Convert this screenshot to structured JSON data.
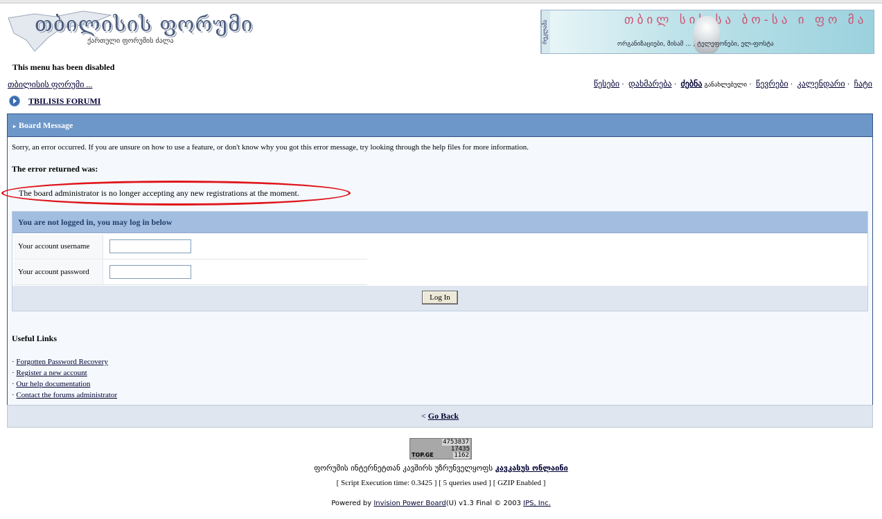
{
  "header": {
    "logo_title": "თბილისის ფორუმი",
    "logo_subtitle": "ქართული ფორუმის ძალა",
    "banner_tab": "რეკლამა",
    "banner_title": "თბილ სის სა ბო-სა ი ფო მა ო ს ცი ა",
    "banner_subtitle": "ორგანიზაციები, მისამ ... , ტელეფონები, ელ-ფოსტა"
  },
  "menu_disabled": "This menu has been disabled",
  "breadcrumb": "თბილისის ფორუმი ...",
  "nav": {
    "rules": "წესები",
    "help": "დახმარება",
    "search": "ძებნა",
    "search_note": "განახლებული",
    "members": "წევრები",
    "calendar": "კალენდარი",
    "chat": "ჩატი"
  },
  "forum_title": "TBILISIS FORUMI",
  "board": {
    "title": "Board Message",
    "message": "Sorry, an error occurred. If you are unsure on how to use a feature, or don't know why you got this error message, try looking through the help files for more information.",
    "error_label": "The error returned was:",
    "error_text": "The board administrator is no longer accepting any new registrations at the moment."
  },
  "login": {
    "title": "You are not logged in, you may log in below",
    "username_label": "Your account username",
    "username_value": "",
    "password_label": "Your account password",
    "password_value": "",
    "button": "Log In"
  },
  "useful": {
    "title": "Useful Links",
    "links": [
      "Forgotten Password Recovery",
      "Register a new account",
      "Our help documentation",
      "Contact the forums administrator"
    ]
  },
  "goback": {
    "prefix": "<",
    "label": "Go Back"
  },
  "counter": {
    "line1": "4753837",
    "line2": "17435",
    "line3": "1162",
    "brand": "TOP.GE"
  },
  "footer": {
    "isp_text": "ფორუმის ინტერნეტთან კავშირს უზრუნველყოფს",
    "isp_link": "კავკასუს ონლაინი",
    "stats": "[ Script Execution time: 0.3425 ]   [ 5 queries used ]   [ GZIP Enabled ]",
    "powered_prefix": "Powered by",
    "powered_link": "Invision Power Board",
    "powered_version": "(U) v1.3 Final © 2003",
    "ips_link": "IPS, Inc."
  },
  "colors": {
    "header_blue": "#6d97c9",
    "subheader_blue": "#a2bde0",
    "highlight_red": "#e0161c"
  }
}
